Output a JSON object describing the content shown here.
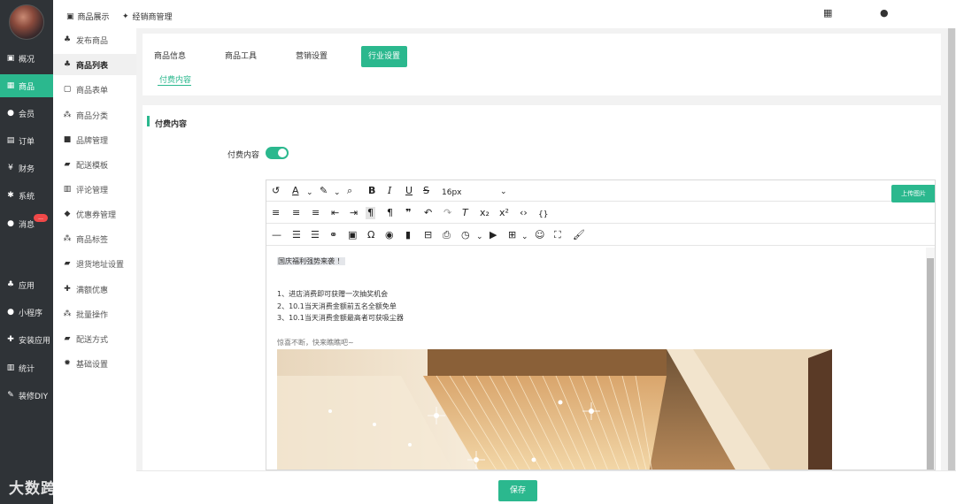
{
  "sidebar_main": [
    {
      "label": "概况",
      "icon": "chart-square-icon"
    },
    {
      "label": "商品",
      "icon": "grid-icon",
      "active": true
    },
    {
      "label": "会员",
      "icon": "users-icon"
    },
    {
      "label": "订单",
      "icon": "cart-icon"
    },
    {
      "label": "财务",
      "icon": "yen-icon"
    },
    {
      "label": "系统",
      "icon": "gears-icon"
    },
    {
      "label": "消息",
      "icon": "chat-icon",
      "badge": "..."
    },
    {
      "label": "应用",
      "icon": "cubes-icon"
    },
    {
      "label": "小程序",
      "icon": "wechat-icon"
    },
    {
      "label": "安装应用",
      "icon": "puzzle-icon"
    },
    {
      "label": "统计",
      "icon": "bar-chart-icon"
    },
    {
      "label": "装修DIY",
      "icon": "wrench-icon"
    }
  ],
  "sidebar_sub": [
    {
      "label": "发布商品",
      "icon": "cubes-icon"
    },
    {
      "label": "商品列表",
      "icon": "cubes-icon",
      "active": true
    },
    {
      "label": "商品表单",
      "icon": "form-icon"
    },
    {
      "label": "商品分类",
      "icon": "sitemap-icon"
    },
    {
      "label": "品牌管理",
      "icon": "briefcase-icon"
    },
    {
      "label": "配送模板",
      "icon": "truck-icon"
    },
    {
      "label": "评论管理",
      "icon": "columns-icon"
    },
    {
      "label": "优惠券管理",
      "icon": "tag-icon"
    },
    {
      "label": "商品标签",
      "icon": "sitemap-icon"
    },
    {
      "label": "退货地址设置",
      "icon": "truck-icon"
    },
    {
      "label": "满额优惠",
      "icon": "gift-icon"
    },
    {
      "label": "批量操作",
      "icon": "sitemap-icon"
    },
    {
      "label": "配送方式",
      "icon": "truck-icon"
    },
    {
      "label": "基础设置",
      "icon": "gear-icon"
    }
  ],
  "topbar": {
    "tab1": "商品展示",
    "tab2": "经销商管理",
    "right_icon1": "apps-grid-icon",
    "right_icon2": "user-icon"
  },
  "tabs": [
    "商品信息",
    "商品工具",
    "营销设置",
    "行业设置"
  ],
  "active_tab": "行业设置",
  "subtab": "付费内容",
  "section": {
    "title": "付费内容",
    "field_label": "付费内容",
    "toggle_on": true
  },
  "editor": {
    "font_size": "16px",
    "upload_label": "上传图片",
    "lines": [
      "国庆福利强势来袭 ！",
      "1、进店消费即可获赠一次抽奖机会",
      "2、10.1当天消费金额前五名全额免单",
      "3、10.1当天消费金额最高者可获吸尘器",
      "惊喜不断，快来瞧瞧吧~"
    ]
  },
  "save_label": "保存",
  "watermark": "大数跨境",
  "colors": {
    "accent": "#2bb88e",
    "sidebar_bg": "#2f3337",
    "badge": "#f04848"
  }
}
